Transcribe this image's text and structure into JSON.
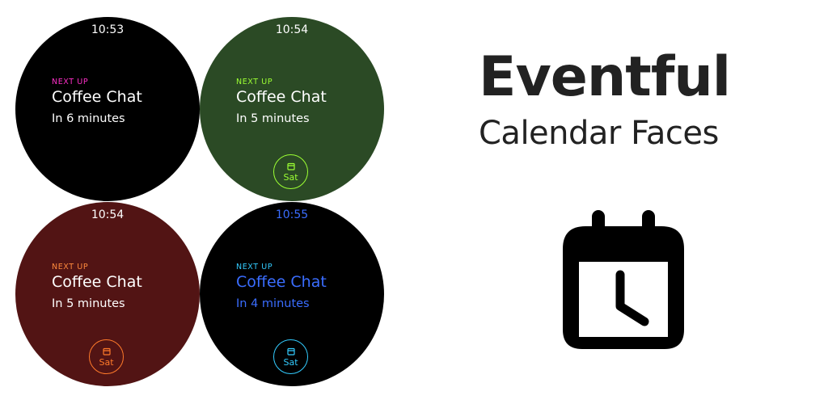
{
  "faces": [
    {
      "time": "10:53",
      "label": "NEXT UP",
      "title": "Coffee Chat",
      "eta": "In 6 minutes",
      "day": null,
      "colors": {
        "bg": "#000000",
        "label": "#ff2fc8",
        "text": "#ffffff",
        "time": "#ffffff",
        "chip": null
      }
    },
    {
      "time": "10:54",
      "label": "NEXT UP",
      "title": "Coffee Chat",
      "eta": "In 5 minutes",
      "day": "Sat",
      "colors": {
        "bg": "#2b4a25",
        "label": "#9cff33",
        "text": "#ffffff",
        "time": "#ffffff",
        "chip": "#9cff33"
      }
    },
    {
      "time": "10:54",
      "label": "NEXT UP",
      "title": "Coffee Chat",
      "eta": "In 5 minutes",
      "day": "Sat",
      "colors": {
        "bg": "#521414",
        "label": "#ff8a3d",
        "text": "#ffffff",
        "time": "#ffffff",
        "chip": "#ff7a2a"
      }
    },
    {
      "time": "10:55",
      "label": "NEXT UP",
      "title": "Coffee Chat",
      "eta": "In 4 minutes",
      "day": "Sat",
      "colors": {
        "bg": "#000000",
        "label": "#33ccff",
        "text": "#3a6dff",
        "time": "#3a6dff",
        "chip": "#33ccff"
      }
    }
  ],
  "brand": {
    "title": "Eventful",
    "subtitle": "Calendar Faces",
    "icon": "calendar-clock-icon"
  }
}
